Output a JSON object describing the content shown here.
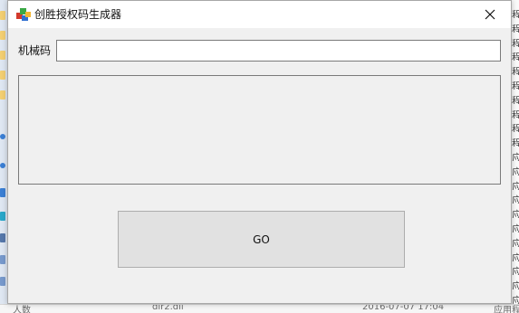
{
  "window": {
    "title": "创胜授权码生成器"
  },
  "form": {
    "machine_code_label": "机械码",
    "machine_code_value": "",
    "output_value": "",
    "go_label": "GO"
  },
  "background": {
    "right_strip_chars": [
      "程",
      "程",
      "程",
      "程",
      "程",
      "程",
      "程",
      "程",
      "程",
      "程",
      "应",
      "应",
      "应",
      "应",
      "应",
      "应",
      "应",
      "应",
      "应",
      "应",
      "应"
    ],
    "bottom_label_left": "人数",
    "bottom_file": "dir2.dll",
    "bottom_date": "2016-07-07 17:04",
    "bottom_type": "应用程"
  },
  "colors": {
    "window_bg": "#f0f0f0",
    "titlebar_bg": "#ffffff",
    "button_bg": "#e1e1e1"
  }
}
